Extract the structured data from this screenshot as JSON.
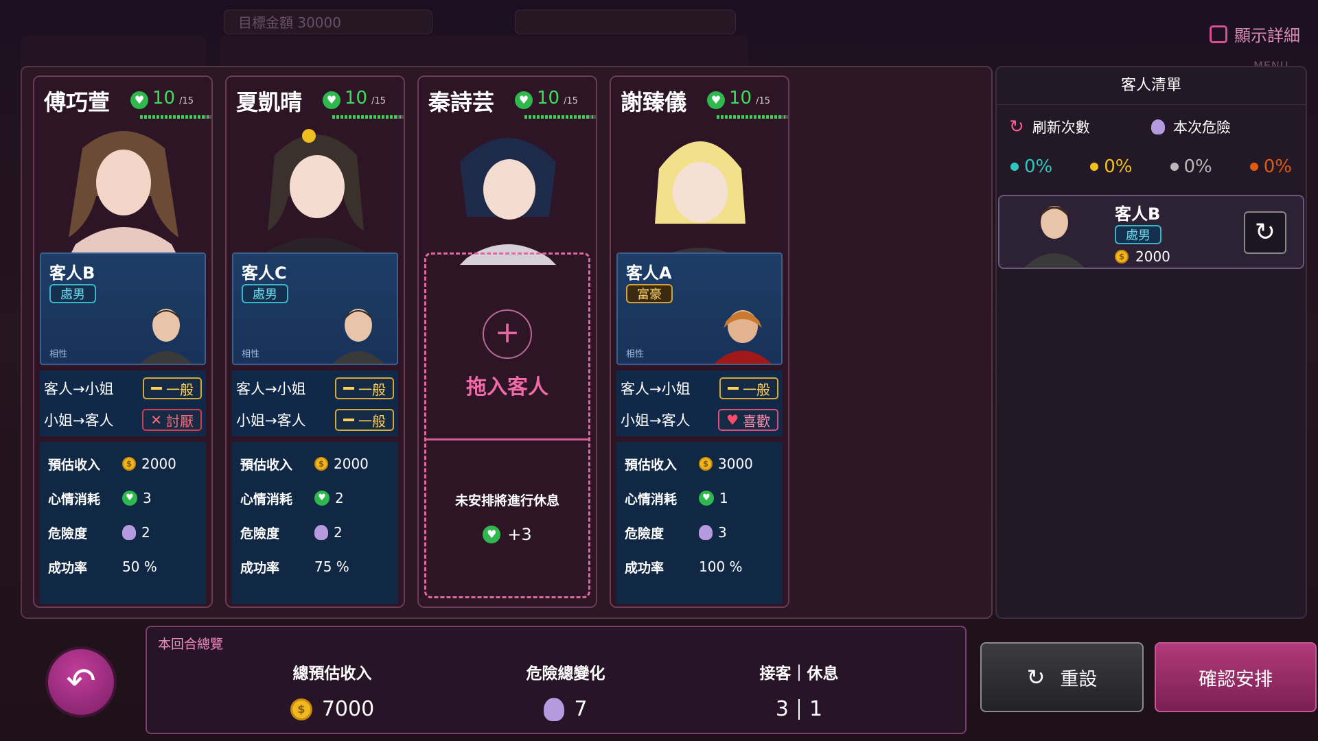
{
  "top": {
    "target_label": "目標金額 30000",
    "detail_toggle_label": "顯示詳細",
    "menu_label": "MENU"
  },
  "cards": [
    {
      "name": "傅巧萱",
      "hp": "10",
      "hp_max": "/15",
      "guest": {
        "name": "客人B",
        "tag": "處男",
        "compat_label": "相性"
      },
      "rel": {
        "c2g_label": "客人→小姐",
        "c2g_value": "一般",
        "g2c_label": "小姐→客人",
        "g2c_value": "討厭"
      },
      "stats": {
        "income_label": "預估收入",
        "income": "2000",
        "mood_label": "心情消耗",
        "mood": "3",
        "danger_label": "危險度",
        "danger": "2",
        "success_label": "成功率",
        "success": "50 %"
      }
    },
    {
      "name": "夏凱晴",
      "hp": "10",
      "hp_max": "/15",
      "guest": {
        "name": "客人C",
        "tag": "處男",
        "compat_label": "相性"
      },
      "rel": {
        "c2g_label": "客人→小姐",
        "c2g_value": "一般",
        "g2c_label": "小姐→客人",
        "g2c_value": "一般"
      },
      "stats": {
        "income_label": "預估收入",
        "income": "2000",
        "mood_label": "心情消耗",
        "mood": "2",
        "danger_label": "危險度",
        "danger": "2",
        "success_label": "成功率",
        "success": "75 %"
      }
    },
    {
      "name": "秦詩芸",
      "hp": "10",
      "hp_max": "/15",
      "drop_label": "拖入客人",
      "rest_note": "未安排將進行休息",
      "rest_bonus": "+3"
    },
    {
      "name": "謝臻儀",
      "hp": "10",
      "hp_max": "/15",
      "guest": {
        "name": "客人A",
        "tag": "富豪",
        "compat_label": "相性"
      },
      "rel": {
        "c2g_label": "客人→小姐",
        "c2g_value": "一般",
        "g2c_label": "小姐→客人",
        "g2c_value": "喜歡"
      },
      "stats": {
        "income_label": "預估收入",
        "income": "3000",
        "mood_label": "心情消耗",
        "mood": "1",
        "danger_label": "危險度",
        "danger": "3",
        "success_label": "成功率",
        "success": "100 %"
      }
    }
  ],
  "side": {
    "title": "客人清單",
    "refresh_label": "刷新次數",
    "danger_label": "本次危險",
    "pcts": [
      {
        "value": "0%",
        "color": "#2ec8c0"
      },
      {
        "value": "0%",
        "color": "#f0c020"
      },
      {
        "value": "0%",
        "color": "#b8b8b8"
      },
      {
        "value": "0%",
        "color": "#e05a10"
      }
    ],
    "guest": {
      "name": "客人B",
      "tag": "處男",
      "money": "2000"
    }
  },
  "summary": {
    "title": "本回合總覽",
    "income_label": "總預估收入",
    "income": "7000",
    "danger_label": "危險總變化",
    "danger": "7",
    "work_rest_label": "接客｜休息",
    "work": "3",
    "rest": "1"
  },
  "buttons": {
    "reset": "重設",
    "confirm": "確認安排"
  },
  "hp_fill": 0.667,
  "colors": {
    "accent": "#e06aa0",
    "heart": "#2fb84d",
    "coin": "#f0b820"
  }
}
